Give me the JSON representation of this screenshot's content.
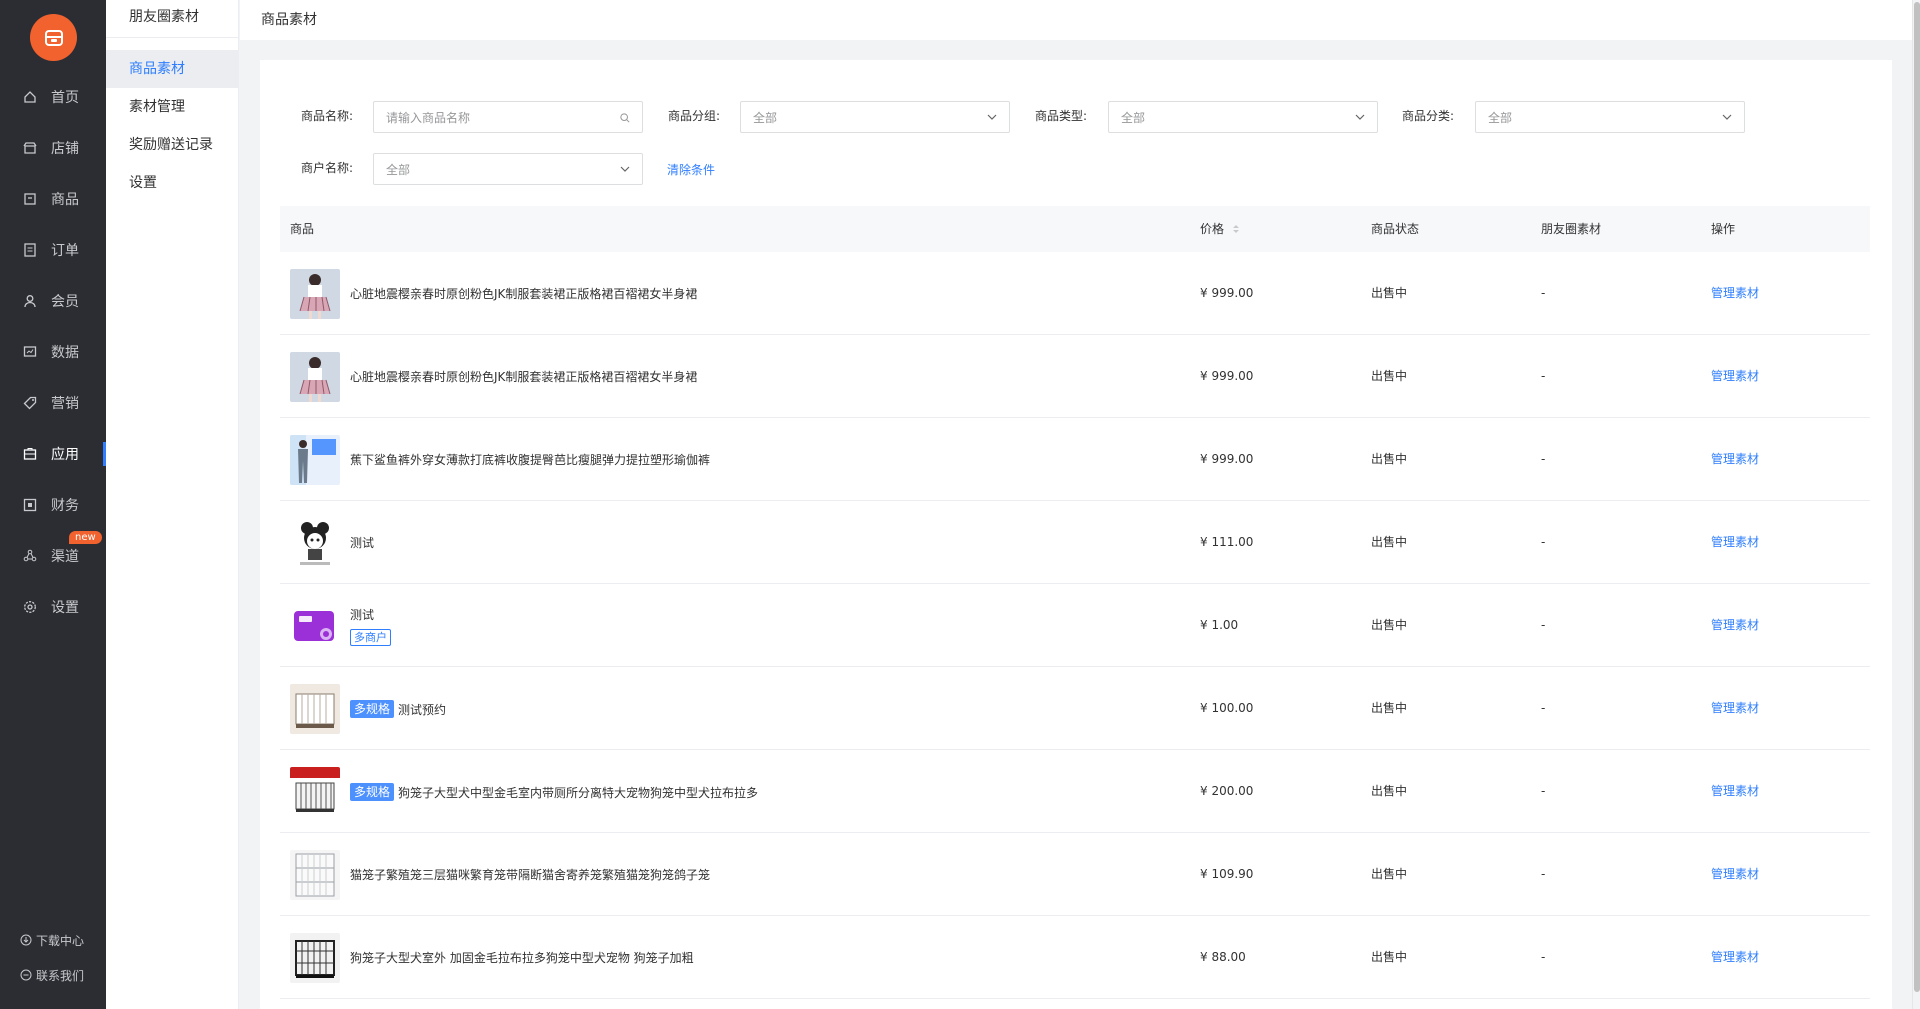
{
  "nav": {
    "items": [
      {
        "label": "首页",
        "icon": "home-icon"
      },
      {
        "label": "店铺",
        "icon": "shop-icon"
      },
      {
        "label": "商品",
        "icon": "goods-icon"
      },
      {
        "label": "订单",
        "icon": "order-icon"
      },
      {
        "label": "会员",
        "icon": "member-icon"
      },
      {
        "label": "数据",
        "icon": "data-icon"
      },
      {
        "label": "营销",
        "icon": "tag-icon"
      },
      {
        "label": "应用",
        "icon": "app-icon"
      },
      {
        "label": "财务",
        "icon": "finance-icon"
      },
      {
        "label": "渠道",
        "icon": "channel-icon",
        "badge": "new"
      },
      {
        "label": "设置",
        "icon": "gear-icon"
      }
    ],
    "active_index": 7,
    "footer": {
      "download": "下载中心",
      "contact": "联系我们"
    },
    "accent": "#2e7eff",
    "logo_color": "#f2622e"
  },
  "subnav": {
    "title": "朋友圈素材",
    "items": [
      "商品素材",
      "素材管理",
      "奖励赠送记录",
      "设置"
    ],
    "active_index": 0
  },
  "header": {
    "title": "商品素材"
  },
  "filters": {
    "name_label": "商品名称:",
    "name_placeholder": "请输入商品名称",
    "group_label": "商品分组:",
    "group_value": "全部",
    "type_label": "商品类型:",
    "type_value": "全部",
    "category_label": "商品分类:",
    "category_value": "全部",
    "merchant_label": "商户名称:",
    "merchant_value": "全部",
    "clear": "清除条件"
  },
  "table": {
    "headers": [
      "商品",
      "价格",
      "商品状态",
      "朋友圈素材",
      "操作"
    ],
    "rows": [
      {
        "name": "心脏地震樱亲春时原创粉色JK制服套装裙正版格裙百褶裙女半身裙",
        "tag": "",
        "merchant_tag": "",
        "price": "¥ 999.00",
        "status": "出售中",
        "material": "-",
        "action": "管理素材",
        "thumb": "skirt"
      },
      {
        "name": "心脏地震樱亲春时原创粉色JK制服套装裙正版格裙百褶裙女半身裙",
        "tag": "",
        "merchant_tag": "",
        "price": "¥ 999.00",
        "status": "出售中",
        "material": "-",
        "action": "管理素材",
        "thumb": "skirt"
      },
      {
        "name": "蕉下鲨鱼裤外穿女薄款打底裤收腹提臀芭比瘦腿弹力提拉塑形瑜伽裤",
        "tag": "",
        "merchant_tag": "",
        "price": "¥ 999.00",
        "status": "出售中",
        "material": "-",
        "action": "管理素材",
        "thumb": "leggings"
      },
      {
        "name": "测试",
        "tag": "",
        "merchant_tag": "",
        "price": "¥ 111.00",
        "status": "出售中",
        "material": "-",
        "action": "管理素材",
        "thumb": "cartoon"
      },
      {
        "name": "测试",
        "tag": "",
        "merchant_tag": "多商户",
        "price": "¥ 1.00",
        "status": "出售中",
        "material": "-",
        "action": "管理素材",
        "thumb": "card"
      },
      {
        "name": "测试预约",
        "tag": "多规格",
        "merchant_tag": "",
        "price": "¥ 100.00",
        "status": "出售中",
        "material": "-",
        "action": "管理素材",
        "thumb": "cage"
      },
      {
        "name": "狗笼子大型犬中型金毛室内带厕所分离特大宠物狗笼中型犬拉布拉多",
        "tag": "多规格",
        "merchant_tag": "",
        "price": "¥ 200.00",
        "status": "出售中",
        "material": "-",
        "action": "管理素材",
        "thumb": "cage-red"
      },
      {
        "name": "猫笼子繁殖笼三层猫咪繁育笼带隔断猫舍寄养笼繁殖猫笼狗笼鸽子笼",
        "tag": "",
        "merchant_tag": "",
        "price": "¥ 109.90",
        "status": "出售中",
        "material": "-",
        "action": "管理素材",
        "thumb": "catcage"
      },
      {
        "name": "狗笼子大型犬室外 加固金毛拉布拉多狗笼中型犬宠物 狗笼子加粗",
        "tag": "",
        "merchant_tag": "",
        "price": "¥ 88.00",
        "status": "出售中",
        "material": "-",
        "action": "管理素材",
        "thumb": "blackcage"
      }
    ]
  }
}
